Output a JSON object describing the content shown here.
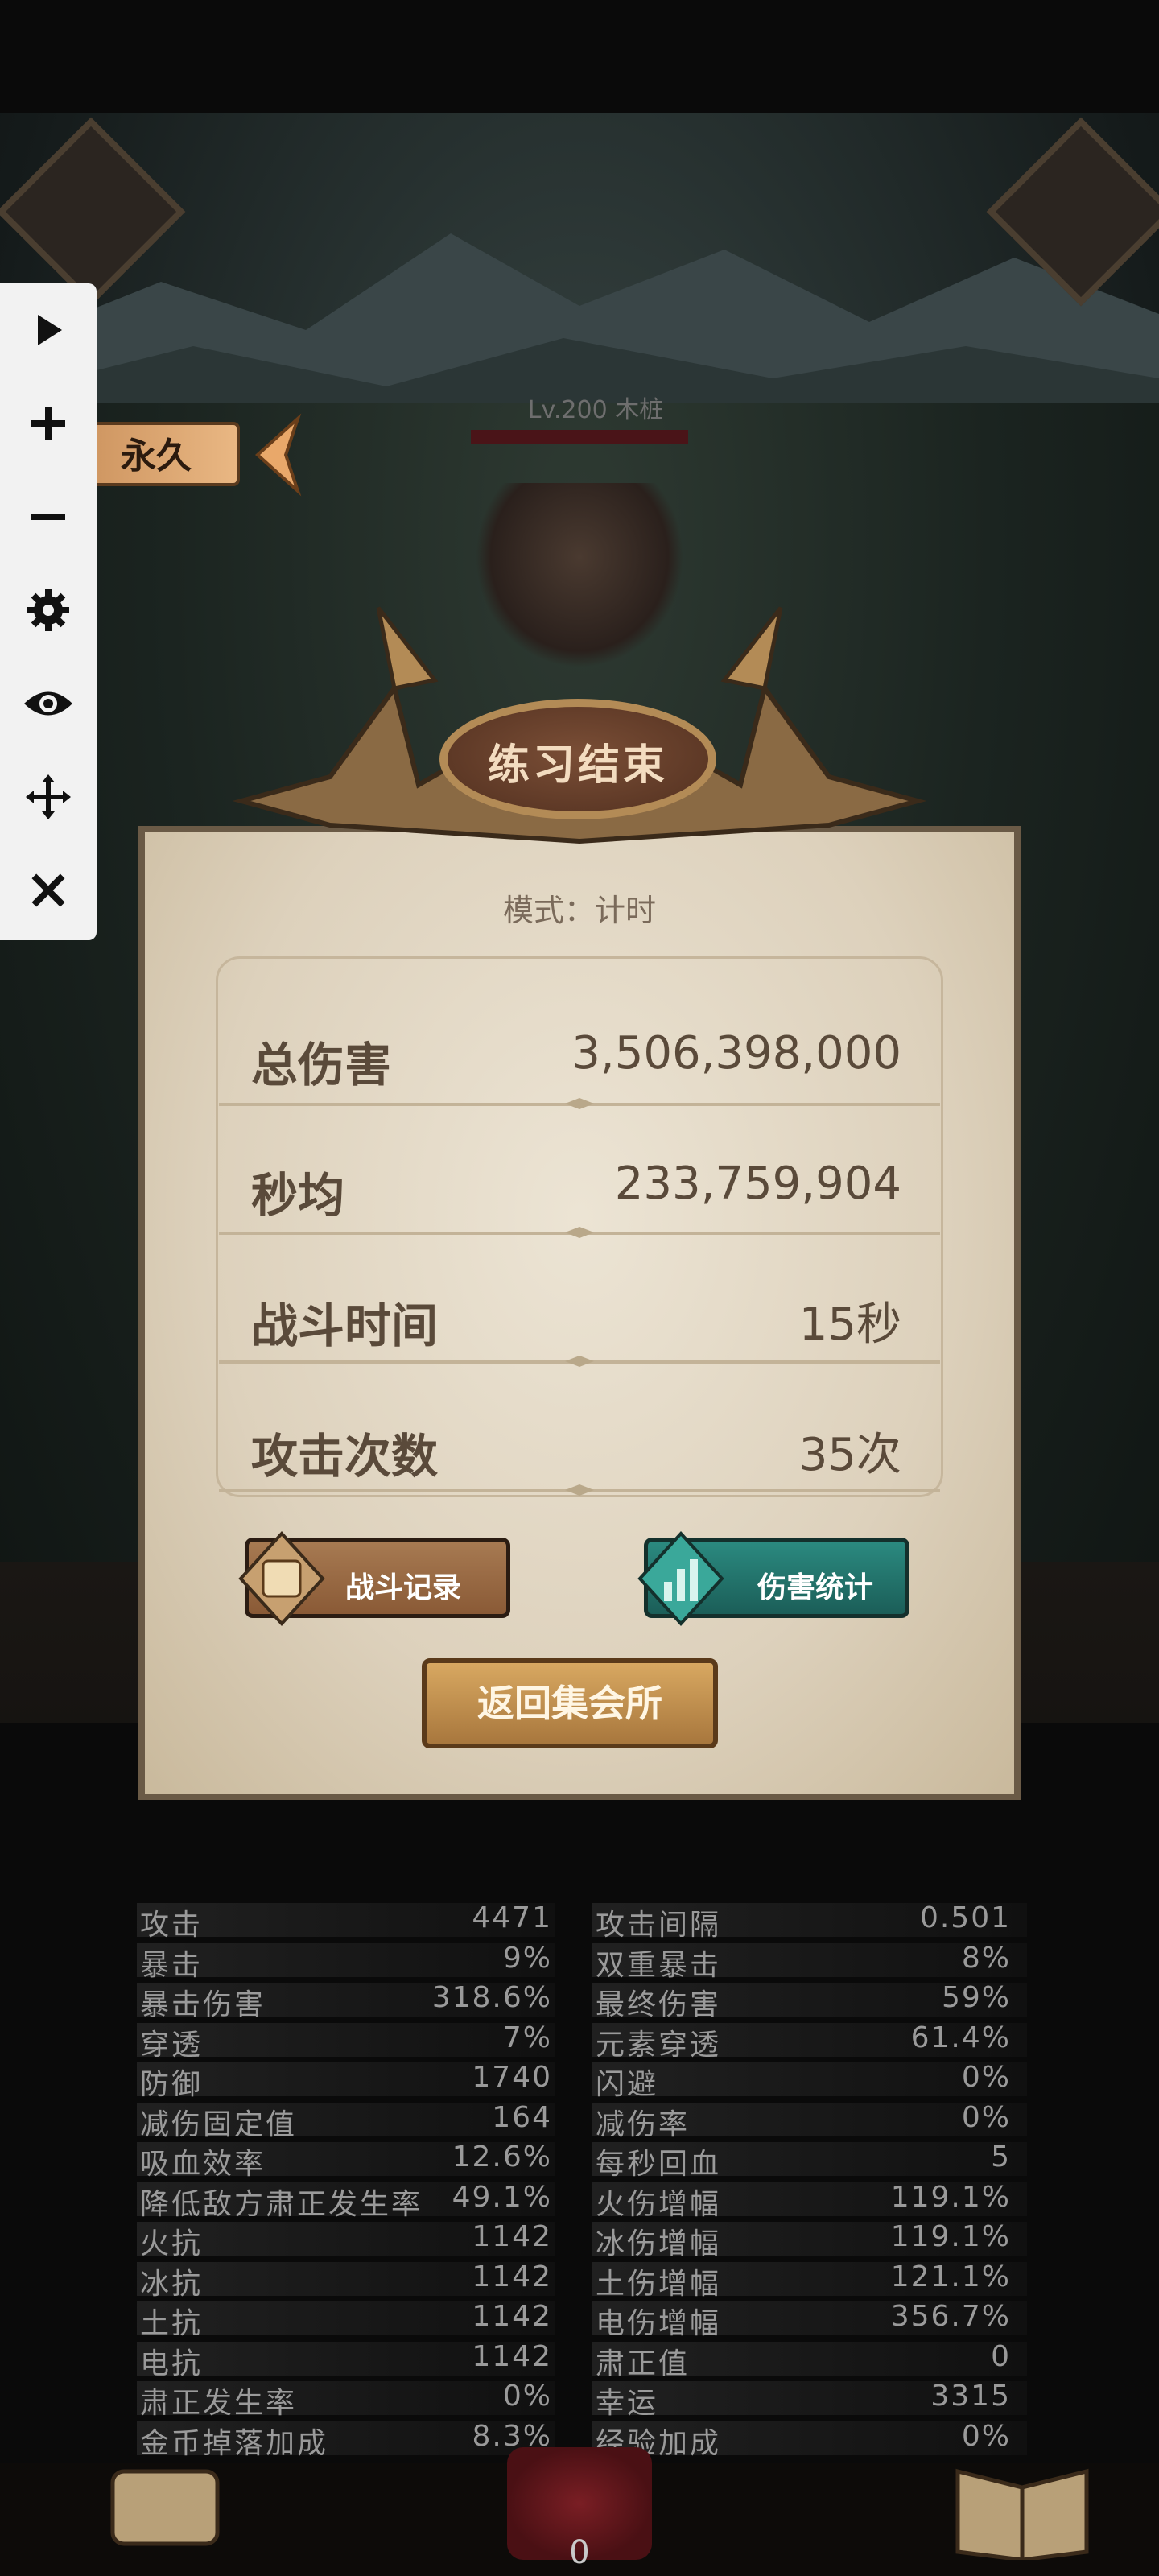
{
  "boss": {
    "level_name": "Lv.200 木桩"
  },
  "permanent_tag": {
    "label": "永久"
  },
  "toolbar": {
    "icons": [
      "play-icon",
      "plus-icon",
      "minus-icon",
      "gear-icon",
      "eye-icon",
      "move-icon",
      "close-icon"
    ]
  },
  "result": {
    "title": "练习结束",
    "mode": "模式：计时",
    "stats": [
      {
        "label": "总伤害",
        "value": "3,506,398,000"
      },
      {
        "label": "秒均",
        "value": "233,759,904"
      },
      {
        "label": "战斗时间",
        "value": "15秒"
      },
      {
        "label": "攻击次数",
        "value": "35次"
      }
    ],
    "buttons": {
      "battle_log": "战斗记录",
      "damage_stats": "伤害统计",
      "return": "返回集会所"
    }
  },
  "attributes": {
    "left": [
      {
        "name": "攻击",
        "value": "4471"
      },
      {
        "name": "暴击",
        "value": "9%"
      },
      {
        "name": "暴击伤害",
        "value": "318.6%"
      },
      {
        "name": "穿透",
        "value": "7%"
      },
      {
        "name": "防御",
        "value": "1740"
      },
      {
        "name": "减伤固定值",
        "value": "164"
      },
      {
        "name": "吸血效率",
        "value": "12.6%"
      },
      {
        "name": "降低敌方肃正发生率",
        "value": "49.1%"
      },
      {
        "name": "火抗",
        "value": "1142"
      },
      {
        "name": "冰抗",
        "value": "1142"
      },
      {
        "name": "土抗",
        "value": "1142"
      },
      {
        "name": "电抗",
        "value": "1142"
      },
      {
        "name": "肃正发生率",
        "value": "0%"
      },
      {
        "name": "金币掉落加成",
        "value": "8.3%"
      }
    ],
    "right": [
      {
        "name": "攻击间隔",
        "value": "0.501"
      },
      {
        "name": "双重暴击",
        "value": "8%"
      },
      {
        "name": "最终伤害",
        "value": "59%"
      },
      {
        "name": "元素穿透",
        "value": "61.4%"
      },
      {
        "name": "闪避",
        "value": "0%"
      },
      {
        "name": "减伤率",
        "value": "0%"
      },
      {
        "name": "每秒回血",
        "value": "5"
      },
      {
        "name": "火伤增幅",
        "value": "119.1%"
      },
      {
        "name": "冰伤增幅",
        "value": "119.1%"
      },
      {
        "name": "土伤增幅",
        "value": "121.1%"
      },
      {
        "name": "电伤增幅",
        "value": "356.7%"
      },
      {
        "name": "肃正值",
        "value": "0"
      },
      {
        "name": "幸运",
        "value": "3315"
      },
      {
        "name": "经验加成",
        "value": "0%"
      }
    ]
  },
  "bottom": {
    "page": "0"
  }
}
